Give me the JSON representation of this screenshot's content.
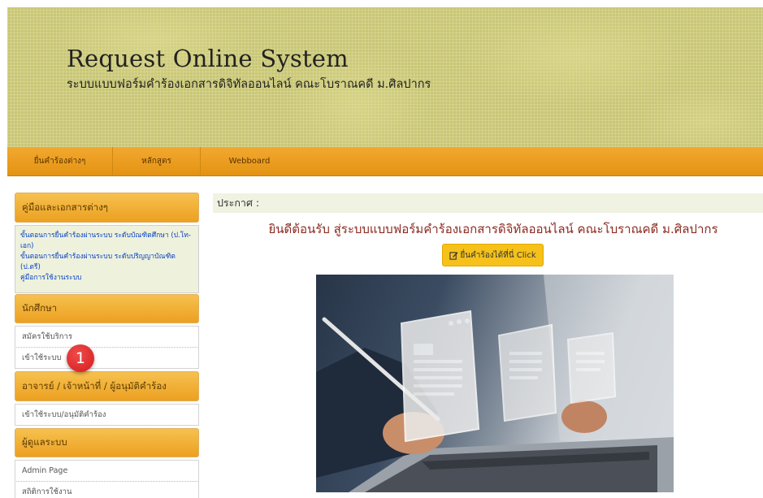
{
  "banner": {
    "title": "Request Online System",
    "subtitle": "ระบบแบบฟอร์มคำร้องเอกสารดิจิทัลออนไลน์ คณะโบราณคดี ม.ศิลปากร"
  },
  "menu": [
    {
      "label": "ยื่นคำร้องต่างๆ"
    },
    {
      "label": "หลักสูตร"
    },
    {
      "label": "Webboard"
    }
  ],
  "sidebar": {
    "docs_heading": "คู่มือและเอกสารต่างๆ",
    "docs": [
      "ขั้นตอนการยื่นคำร้องผ่านระบบ ระดับบัณฑิตศึกษา (ป.โท-เอก)",
      "ขั้นตอนการยื่นคำร้องผ่านระบบ ระดับปริญญาบัณฑิต (ป.ตรี)",
      "คู่มือการใช้งานระบบ"
    ],
    "student_heading": "นักศึกษา",
    "student_links": [
      "สมัครใช้บริการ",
      "เข้าใช้ระบบ"
    ],
    "staff_heading": "อาจารย์ / เจ้าหน้าที่ / ผู้อนุมัติคำร้อง",
    "staff_links": [
      "เข้าใช้ระบบ/อนุมัติคำร้อง"
    ],
    "admin_heading": "ผู้ดูแลระบบ",
    "admin_links": [
      "Admin Page",
      "สถิติการใช้งาน"
    ]
  },
  "annotation": {
    "badge": "1"
  },
  "main": {
    "notice_label": "ประกาศ :",
    "welcome": "ยินดีต้อนรับ สู่ระบบแบบฟอร์มคำร้องเอกสารดิจิทัลออนไลน์ คณะโบราณคดี ม.ศิลปากร",
    "cta_label": "ยื่นคำร้องได้ที่นี่ Click"
  },
  "colors": {
    "menu_orange": "#e8991a",
    "banner_olive": "#c9c776",
    "cta_yellow": "#f5c11a",
    "welcome_red": "#8a2a20",
    "link_blue": "#0a43c4"
  },
  "icons": {
    "cta": "edit-icon"
  }
}
